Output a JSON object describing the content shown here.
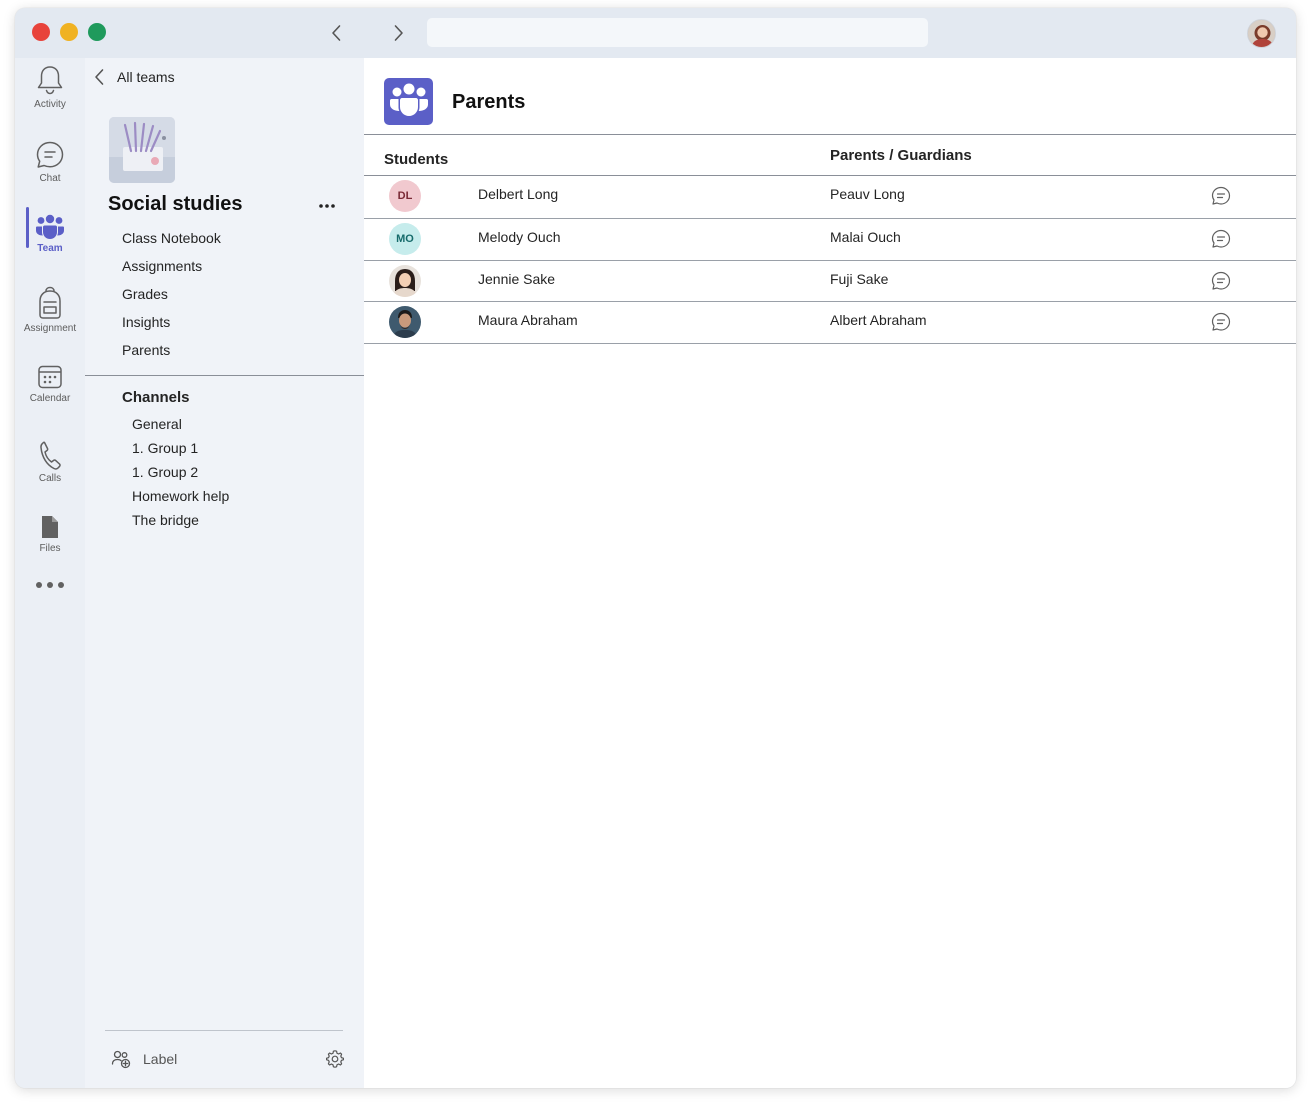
{
  "window": {
    "search": {
      "value": "",
      "placeholder": ""
    }
  },
  "rail": {
    "items": [
      {
        "label": "Activity",
        "icon": "bell-icon"
      },
      {
        "label": "Chat",
        "icon": "chat-icon"
      },
      {
        "label": "Team",
        "icon": "team-icon",
        "active": true
      },
      {
        "label": "Assignment",
        "icon": "backpack-icon"
      },
      {
        "label": "Calendar",
        "icon": "calendar-icon"
      },
      {
        "label": "Calls",
        "icon": "phone-icon"
      },
      {
        "label": "Files",
        "icon": "file-icon"
      }
    ]
  },
  "sidebar": {
    "back_label": "All teams",
    "team_name": "Social studies",
    "nav": [
      "Class Notebook",
      "Assignments",
      "Grades",
      "Insights",
      "Parents"
    ],
    "channels_title": "Channels",
    "channels": [
      "General",
      "1. Group 1",
      "1. Group 2",
      "Homework help",
      "The bridge"
    ],
    "footer_label": "Label"
  },
  "main": {
    "title": "Parents",
    "columns": {
      "students": "Students",
      "parents": "Parents / Guardians"
    },
    "rows": [
      {
        "initials": "DL",
        "student": "Delbert Long",
        "parent": "Peauv Long",
        "avatar_bg": "#f1c9cf",
        "avatar_fg": "#7a2a36"
      },
      {
        "initials": "MO",
        "student": "Melody Ouch",
        "parent": "Malai Ouch",
        "avatar_bg": "#c6ecec",
        "avatar_fg": "#166b6b"
      },
      {
        "initials": "",
        "student": "Jennie Sake",
        "parent": "Fuji Sake"
      },
      {
        "initials": "",
        "student": "Maura Abraham",
        "parent": "Albert Abraham"
      }
    ]
  },
  "colors": {
    "accent": "#5b5fc7",
    "close": "#e8433b",
    "minimize": "#f0b222",
    "maximize": "#1f9a5c"
  }
}
